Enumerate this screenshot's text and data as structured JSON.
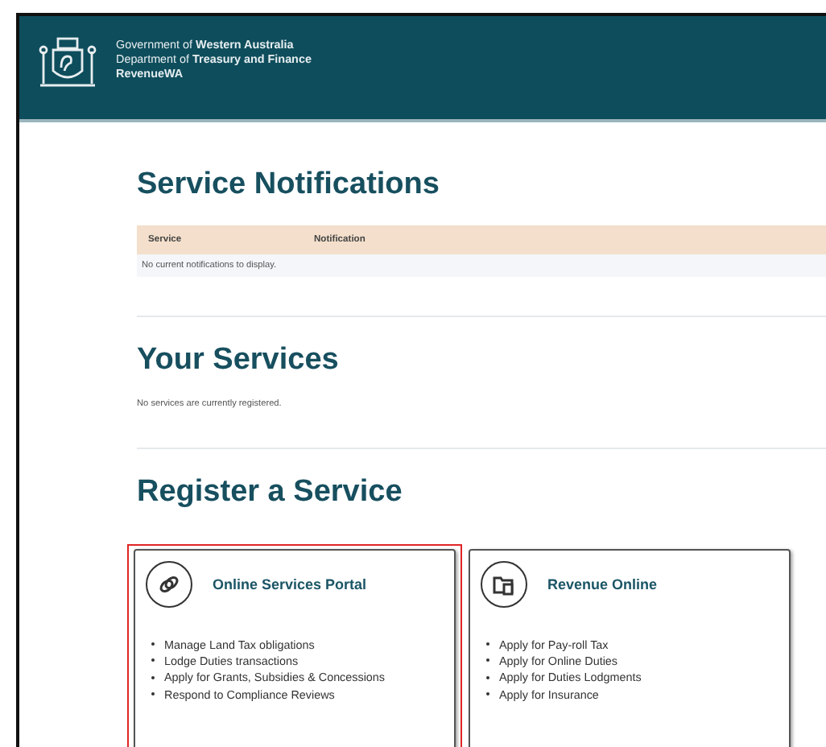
{
  "header": {
    "lines": [
      "Government of **Western Australia**",
      "Department of **Treasury and Finance**",
      "RevenueWA"
    ]
  },
  "notifications": {
    "title": "Service Notifications",
    "columns": [
      "Service",
      "Notification"
    ],
    "empty_text": "No current notifications to display."
  },
  "your_services": {
    "title": "Your Services",
    "empty_text": "No services are currently registered."
  },
  "register": {
    "title": "Register a Service",
    "cards": [
      {
        "kind": "link",
        "title": "Online Services Portal",
        "highlighted": true,
        "items": [
          "Manage Land Tax obligations",
          "Lodge Duties transactions",
          "Apply for Grants, Subsidies & Concessions",
          "Respond to Compliance Reviews"
        ]
      },
      {
        "kind": "folder",
        "title": "Revenue Online",
        "highlighted": false,
        "items": [
          "Apply for Pay-roll Tax",
          "Apply for Online Duties",
          "Apply for Duties Lodgments",
          "Apply for Insurance"
        ]
      }
    ]
  }
}
